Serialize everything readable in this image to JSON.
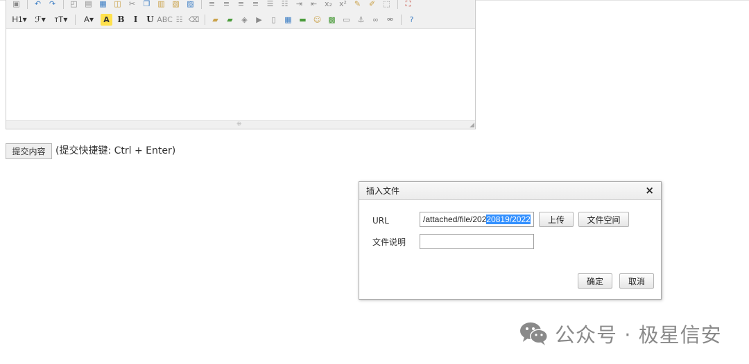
{
  "editor": {
    "toolbar_row1": [
      {
        "name": "source-icon",
        "glyph": "▣",
        "cls": "ic-gray"
      },
      {
        "sep": true
      },
      {
        "name": "undo-icon",
        "glyph": "↶",
        "cls": "ic-blue"
      },
      {
        "name": "redo-icon",
        "glyph": "↷",
        "cls": "ic-blue"
      },
      {
        "sep": true
      },
      {
        "name": "preview-icon",
        "glyph": "◰",
        "cls": "ic-gray"
      },
      {
        "name": "print-icon",
        "glyph": "▤",
        "cls": "ic-gray"
      },
      {
        "name": "template-icon",
        "glyph": "▦",
        "cls": "ic-blue"
      },
      {
        "name": "code-icon",
        "glyph": "◫",
        "cls": "ic-gold"
      },
      {
        "name": "cut-icon",
        "glyph": "✂",
        "cls": "ic-gray"
      },
      {
        "name": "copy-icon",
        "glyph": "❐",
        "cls": "ic-blue"
      },
      {
        "name": "paste-icon",
        "glyph": "▥",
        "cls": "ic-gold"
      },
      {
        "name": "paste-text-icon",
        "glyph": "▧",
        "cls": "ic-gold"
      },
      {
        "name": "paste-word-icon",
        "glyph": "▨",
        "cls": "ic-blue"
      },
      {
        "sep": true
      },
      {
        "name": "align-left-icon",
        "glyph": "≡",
        "cls": "ic-gray"
      },
      {
        "name": "align-center-icon",
        "glyph": "≡",
        "cls": "ic-gray"
      },
      {
        "name": "align-right-icon",
        "glyph": "≡",
        "cls": "ic-gray"
      },
      {
        "name": "justify-icon",
        "glyph": "≡",
        "cls": "ic-gray"
      },
      {
        "name": "ordered-list-icon",
        "glyph": "☰",
        "cls": "ic-gray"
      },
      {
        "name": "unordered-list-icon",
        "glyph": "☷",
        "cls": "ic-gray"
      },
      {
        "name": "indent-icon",
        "glyph": "⇥",
        "cls": "ic-gray"
      },
      {
        "name": "outdent-icon",
        "glyph": "⇤",
        "cls": "ic-gray"
      },
      {
        "name": "subscript-icon",
        "glyph": "x₂",
        "cls": "ic-gray"
      },
      {
        "name": "superscript-icon",
        "glyph": "x²",
        "cls": "ic-gray"
      },
      {
        "name": "clear-format-icon",
        "glyph": "✎",
        "cls": "ic-gold"
      },
      {
        "name": "quickformat-icon",
        "glyph": "✐",
        "cls": "ic-gold"
      },
      {
        "name": "select-all-icon",
        "glyph": "⬚",
        "cls": "ic-gray"
      },
      {
        "sep": true
      },
      {
        "name": "fullscreen-icon",
        "glyph": "⛶",
        "cls": "ic-red"
      }
    ],
    "toolbar_row2": [
      {
        "name": "heading-dropdown",
        "glyph": "H1▾",
        "cls": "wide"
      },
      {
        "name": "font-family-dropdown",
        "glyph": "ℱ▾",
        "cls": "wide"
      },
      {
        "name": "font-size-dropdown",
        "glyph": "тT▾",
        "cls": "wide"
      },
      {
        "sep": true
      },
      {
        "name": "font-color-icon",
        "glyph": "A▾",
        "cls": "wide ic-blue"
      },
      {
        "name": "highlight-color-icon",
        "glyph": "A",
        "cls": "hl-a"
      },
      {
        "name": "bold-icon",
        "glyph": "B",
        "cls": "txt"
      },
      {
        "name": "italic-icon",
        "glyph": "I",
        "cls": "txt"
      },
      {
        "name": "underline-icon",
        "glyph": "U",
        "cls": "txt"
      },
      {
        "name": "strikethrough-icon",
        "glyph": "ABC",
        "cls": "ic-gray"
      },
      {
        "name": "line-height-icon",
        "glyph": "☷",
        "cls": "ic-gray"
      },
      {
        "name": "remove-format-icon",
        "glyph": "⌫",
        "cls": "ic-gray"
      },
      {
        "sep": true
      },
      {
        "name": "image-icon",
        "glyph": "▰",
        "cls": "ic-gold"
      },
      {
        "name": "multi-image-icon",
        "glyph": "▰",
        "cls": "ic-green"
      },
      {
        "name": "flash-icon",
        "glyph": "◈",
        "cls": "ic-gray"
      },
      {
        "name": "media-icon",
        "glyph": "▶",
        "cls": "ic-gray"
      },
      {
        "name": "insert-file-icon",
        "glyph": "▯",
        "cls": "ic-gray"
      },
      {
        "name": "table-icon",
        "glyph": "▦",
        "cls": "ic-blue"
      },
      {
        "name": "hr-icon",
        "glyph": "▬",
        "cls": "ic-green"
      },
      {
        "name": "emoticon-icon",
        "glyph": "☺",
        "cls": "ic-gold"
      },
      {
        "name": "baidu-map-icon",
        "glyph": "▩",
        "cls": "ic-green"
      },
      {
        "name": "page-break-icon",
        "glyph": "▭",
        "cls": "ic-gray"
      },
      {
        "name": "anchor-icon",
        "glyph": "⚓",
        "cls": "ic-gray"
      },
      {
        "name": "link-icon",
        "glyph": "∞",
        "cls": "ic-gray"
      },
      {
        "name": "unlink-icon",
        "glyph": "⚮",
        "cls": "ic-gray"
      },
      {
        "sep": true
      },
      {
        "name": "about-icon",
        "glyph": "?",
        "cls": "ic-blue"
      }
    ]
  },
  "submit": {
    "button_label": "提交内容",
    "hint": "(提交快捷键: Ctrl + Enter)"
  },
  "dialog": {
    "title": "插入文件",
    "close_glyph": "×",
    "url_label": "URL",
    "url_value_plain": "/attached/file/202",
    "url_value_selected": "20819/2022",
    "desc_label": "文件说明",
    "desc_value": "",
    "upload_label": "上传",
    "file_space_label": "文件空间",
    "ok_label": "确定",
    "cancel_label": "取消"
  },
  "watermark": {
    "text": "公众号 · 极星信安"
  },
  "colors": {
    "selection": "#3390ff",
    "toolbar_bg": "#f0f0f0",
    "dialog_border": "#a8a8a8"
  }
}
